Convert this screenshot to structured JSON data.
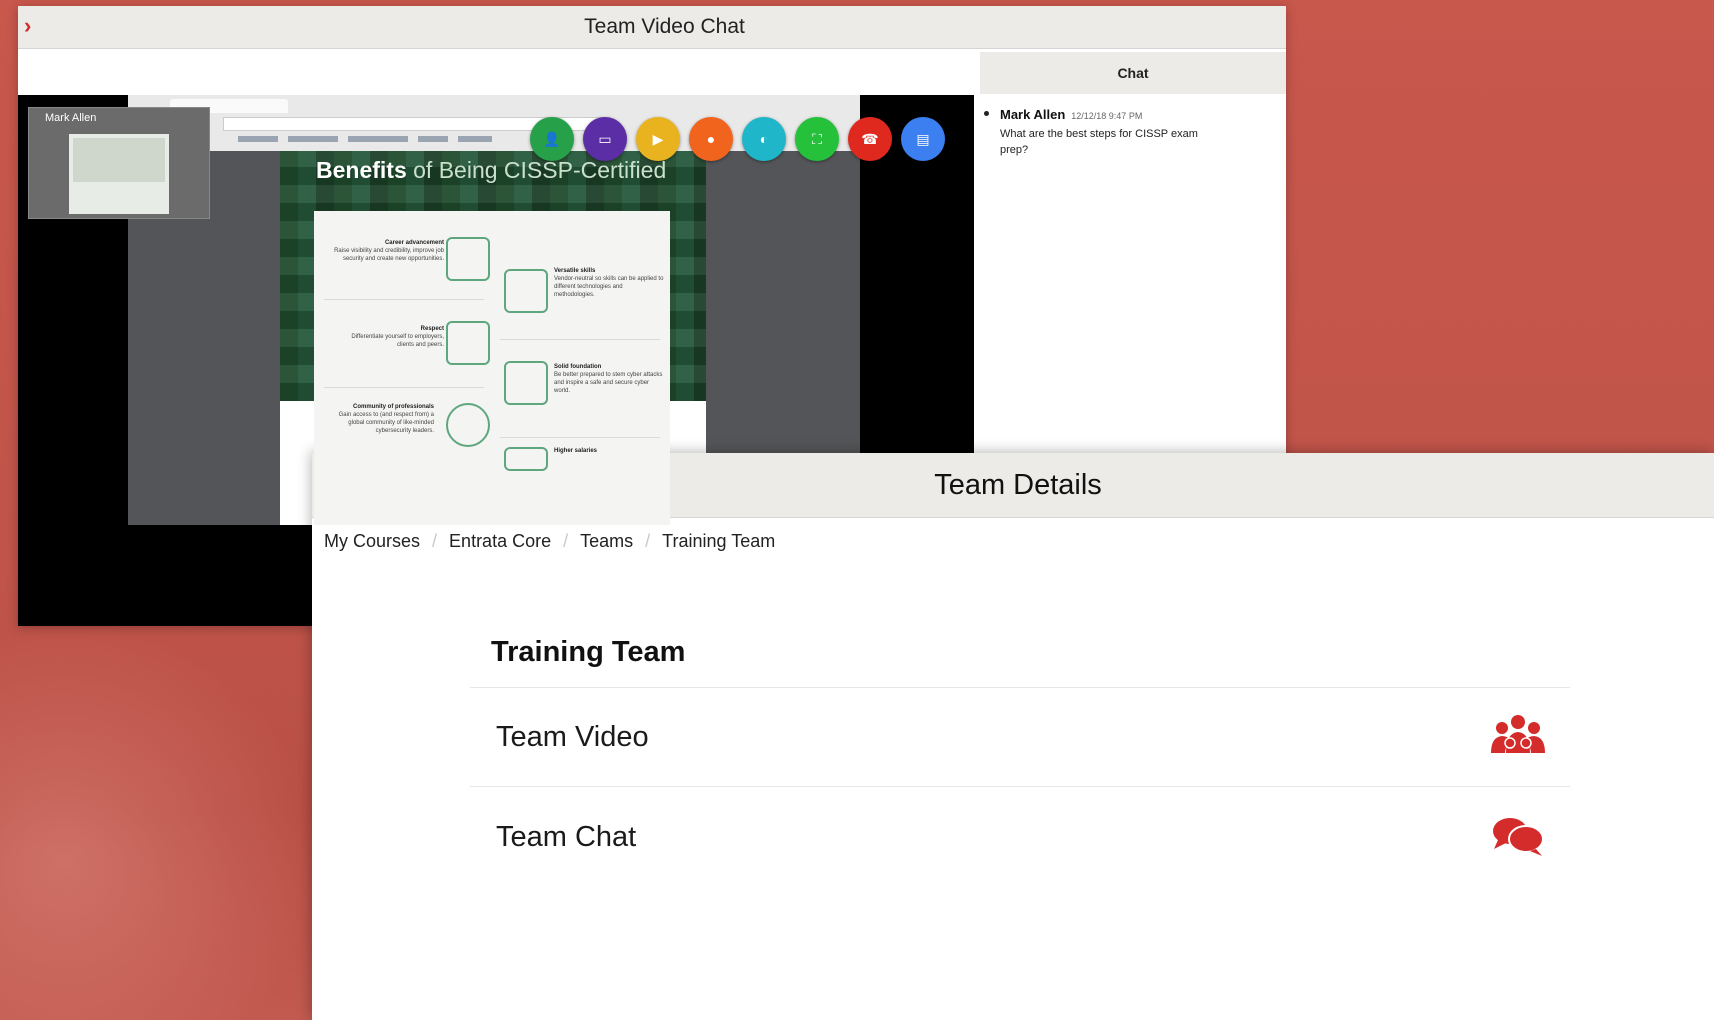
{
  "colors": {
    "accent": "#d42b2b",
    "background": "#c8574c",
    "titlebar": "#ecebe8"
  },
  "video_window": {
    "title": "Team Video Chat",
    "collapse_icon": "chevron-right-icon",
    "self_view_name": "Mark Allen",
    "slide": {
      "title_bold": "Benefits",
      "title_rest": " of Being CISSP-Certified",
      "benefits": [
        {
          "heading": "Career advancement",
          "text": "Raise visibility and credibility, improve job security and create new opportunities."
        },
        {
          "heading": "Versatile skills",
          "text": "Vendor-neutral so skills can be applied to different technologies and methodologies."
        },
        {
          "heading": "Respect",
          "text": "Differentiate yourself to employers, clients and peers."
        },
        {
          "heading": "Solid foundation",
          "text": "Be better prepared to stem cyber attacks and inspire a safe and secure cyber world."
        },
        {
          "heading": "Community of professionals",
          "text": "Gain access to (and respect from) a global community of like-minded cybersecurity leaders."
        },
        {
          "heading": "Higher salaries",
          "text": ""
        }
      ]
    },
    "controls": [
      {
        "name": "participants-icon",
        "color": "#27a04a",
        "glyph": "👤"
      },
      {
        "name": "screen-share-icon",
        "color": "#5b2ea6",
        "glyph": "▭"
      },
      {
        "name": "camera-off-icon",
        "color": "#e8b31e",
        "glyph": "▶"
      },
      {
        "name": "microphone-icon",
        "color": "#f0641e",
        "glyph": "●"
      },
      {
        "name": "speaker-mute-icon",
        "color": "#1fb6c9",
        "glyph": "◐"
      },
      {
        "name": "fullscreen-icon",
        "color": "#26c13a",
        "glyph": "⛶"
      },
      {
        "name": "hang-up-icon",
        "color": "#e0291e",
        "glyph": "☎"
      },
      {
        "name": "chat-toggle-icon",
        "color": "#3b7ff0",
        "glyph": "▤"
      }
    ],
    "chat": {
      "header": "Chat",
      "messages": [
        {
          "author": "Mark Allen",
          "time": "12/12/18 9:47 PM",
          "text": "What are the best steps for CISSP exam prep?"
        }
      ]
    }
  },
  "details_window": {
    "title": "Team Details",
    "back_icon": "chevron-left-icon",
    "breadcrumb": [
      "My Courses",
      "Entrata Core",
      "Teams",
      "Training Team"
    ],
    "breadcrumb_separator": "/",
    "section_title": "Training Team",
    "rows": [
      {
        "label": "Team Video",
        "icon": "team-group-icon"
      },
      {
        "label": "Team Chat",
        "icon": "chat-bubbles-icon"
      }
    ]
  }
}
